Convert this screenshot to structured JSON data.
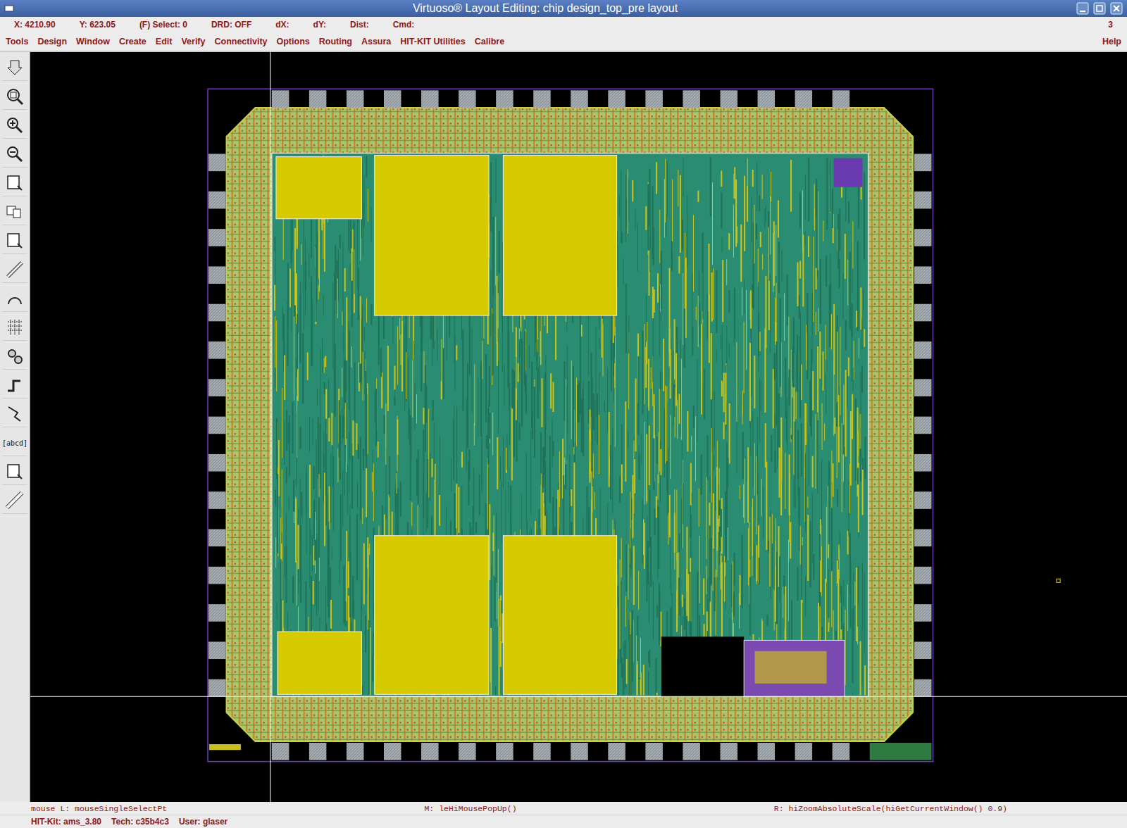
{
  "window": {
    "title": "Virtuoso® Layout Editing: chip design_top_pre layout"
  },
  "status_line": {
    "fields": [
      {
        "label": "X:",
        "value": "4210.90"
      },
      {
        "label": "Y:",
        "value": "623.05"
      },
      {
        "label": "(F) Select:",
        "value": "0"
      },
      {
        "label": "DRD:",
        "value": "OFF"
      },
      {
        "label": "dX:",
        "value": ""
      },
      {
        "label": "dY:",
        "value": ""
      },
      {
        "label": "Dist:",
        "value": ""
      },
      {
        "label": "Cmd:",
        "value": ""
      }
    ],
    "counter": "3"
  },
  "menu": {
    "items": [
      "Tools",
      "Design",
      "Window",
      "Create",
      "Edit",
      "Verify",
      "Connectivity",
      "Options",
      "Routing",
      "Assura",
      "HIT-KIT Utilities",
      "Calibre"
    ],
    "help": "Help"
  },
  "toolbar": {
    "label_tool": "[abcd]"
  },
  "mouse_bar": {
    "left": "mouse L: mouseSingleSelectPt",
    "middle": "M: leHiMousePopUp()",
    "right": "R: hiZoomAbsoluteScale(hiGetCurrentWindow() 0.9)"
  },
  "info_bar": [
    "HIT-Kit: ams_3.80",
    "Tech: c35b4c3",
    "User: glaser"
  ]
}
